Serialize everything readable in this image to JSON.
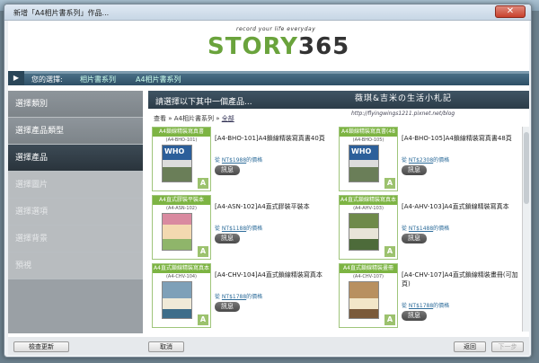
{
  "window": {
    "title": "新增「A4相片書系列」作品...",
    "close_glyph": "✕"
  },
  "logo": {
    "tagline": "record your life everyday",
    "story": "STORY",
    "num": "365"
  },
  "breadcrumb": {
    "play_glyph": "▶",
    "your_choice": "您的選擇:",
    "category": "相片書系列",
    "series": "A4相片書系列"
  },
  "sidebar": {
    "items": [
      {
        "label": "選擇類別",
        "state": "normal"
      },
      {
        "label": "選擇產品類型",
        "state": "normal"
      },
      {
        "label": "選擇產品",
        "state": "active"
      },
      {
        "label": "選擇圖片",
        "state": "disabled"
      },
      {
        "label": "選擇選項",
        "state": "disabled"
      },
      {
        "label": "選擇背景",
        "state": "disabled"
      },
      {
        "label": "預視",
        "state": "disabled"
      }
    ]
  },
  "panel": {
    "heading": "請選擇以下其中一個產品...",
    "watermark": "薇琪&吉米の生活小札記",
    "watermark_url": "http://flyingwings1211.pixnet.net/blog",
    "subheading_prefix": "查看 » A4相片書系列 » ",
    "subheading_link": "全部"
  },
  "products": [
    {
      "category": "A4鎖線精裝寫真書",
      "code": "(A4-BHO-101)",
      "name": "[A4-BHO-101]A4鎖線精裝寫真書40頁",
      "price_prefix": "從 ",
      "price": "NT$1988",
      "price_suffix": "的價格",
      "button": "訊息",
      "cover": "WHO"
    },
    {
      "category": "A4鎖線精裝寫真書(48頁)",
      "code": "(A4-BHO-105)",
      "name": "[A4-BHO-105]A4鎖線精裝寫真書48頁",
      "price_prefix": "從 ",
      "price": "NT$2308",
      "price_suffix": "的價格",
      "button": "訊息",
      "cover": "WHO"
    },
    {
      "category": "A4直式膠裝平裝本",
      "code": "(A4-ASN-102)",
      "name": "[A4-ASN-102]A4直式膠裝平裝本",
      "price_prefix": "從 ",
      "price": "NT$1188",
      "price_suffix": "的價格",
      "button": "訊息",
      "cover": ""
    },
    {
      "category": "A4直式鎖線精裝寫真本",
      "code": "(A4-AHV-103)",
      "name": "[A4-AHV-103]A4直式鎖線精裝寫真本",
      "price_prefix": "從 ",
      "price": "NT$1488",
      "price_suffix": "的價格",
      "button": "訊息",
      "cover": ""
    },
    {
      "category": "A4直式鎖線精裝寫真本",
      "code": "(A4-CHV-104)",
      "name": "[A4-CHV-104]A4直式鎖線精裝寫真本",
      "price_prefix": "從 ",
      "price": "NT$1788",
      "price_suffix": "的價格",
      "button": "訊息",
      "cover": ""
    },
    {
      "category": "A4直式鎖線精裝畫冊",
      "code": "(A4-CHV-107)",
      "name": "[A4-CHV-107]A4直式鎖線精裝畫冊(可加頁)",
      "price_prefix": "從 ",
      "price": "NT$1788",
      "price_suffix": "的價格",
      "button": "訊息",
      "cover": ""
    }
  ],
  "footer": {
    "update_check": "檢查更新",
    "cancel": "取消",
    "back": "返回",
    "next": "下一步"
  },
  "colors": {
    "brand_green": "#6aa33c",
    "brand_red": "#c8372d",
    "header_dark": "#2c3c48"
  }
}
